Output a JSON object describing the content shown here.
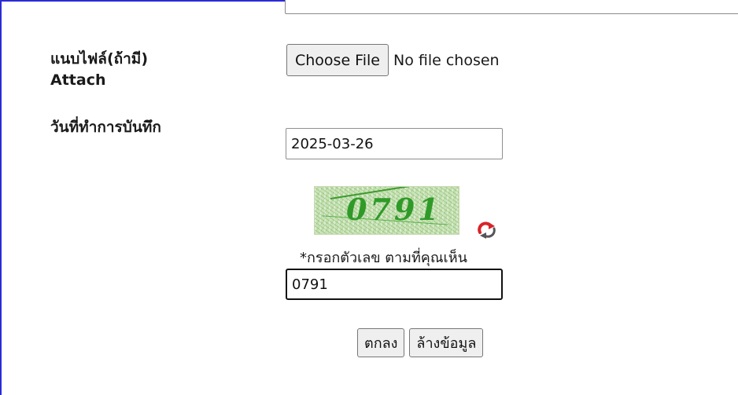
{
  "form": {
    "attach_label_th": "แนบไฟล์(ถ้ามี)",
    "attach_label_en": "Attach",
    "file_button": "Choose File",
    "file_status": "No file chosen",
    "date_label": "วันที่ทำการบันทึก",
    "date_value": "2025-03-26",
    "captcha_image_text": "0791",
    "captcha_hint": "*กรอกตัวเลข ตามที่คุณเห็น",
    "captcha_value": "0791",
    "submit_label": "ตกลง",
    "reset_label": "ล้างข้อมูล"
  },
  "icons": {
    "refresh": "refresh-icon"
  },
  "colors": {
    "frame_border": "#2b2bd6",
    "captcha_text": "#2f9a28",
    "captcha_bg": "#c8e2b6",
    "refresh_icon": "#d8232a"
  }
}
